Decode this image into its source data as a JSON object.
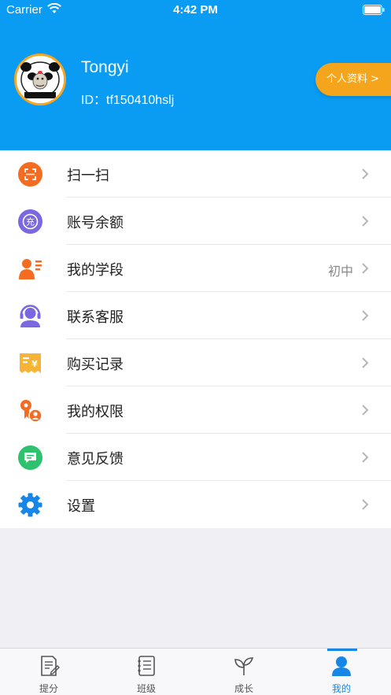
{
  "status_bar": {
    "carrier": "Carrier",
    "time": "4:42 PM"
  },
  "profile": {
    "name": "Tongyi",
    "id_text": "ID：tf150410hslj",
    "profile_button": "个人资料 >"
  },
  "menu": {
    "items": [
      {
        "label": "扫一扫",
        "icon": "scan-icon",
        "value": ""
      },
      {
        "label": "账号余额",
        "icon": "recharge-icon",
        "value": ""
      },
      {
        "label": "我的学段",
        "icon": "student-card-icon",
        "value": "初中"
      },
      {
        "label": "联系客服",
        "icon": "customer-service-icon",
        "value": ""
      },
      {
        "label": "购买记录",
        "icon": "receipt-icon",
        "value": ""
      },
      {
        "label": "我的权限",
        "icon": "key-user-icon",
        "value": ""
      },
      {
        "label": "意见反馈",
        "icon": "feedback-icon",
        "value": ""
      },
      {
        "label": "设置",
        "icon": "gear-icon",
        "value": ""
      }
    ]
  },
  "tabs": [
    {
      "label": "提分",
      "icon": "exam-paper-icon"
    },
    {
      "label": "班级",
      "icon": "notebook-icon"
    },
    {
      "label": "成长",
      "icon": "sprout-icon"
    },
    {
      "label": "我的",
      "icon": "person-icon",
      "active": true
    }
  ],
  "colors": {
    "header_bg": "#0a9bf2",
    "profile_button_bg": "#f5a51c",
    "active_tab": "#1687e6"
  }
}
